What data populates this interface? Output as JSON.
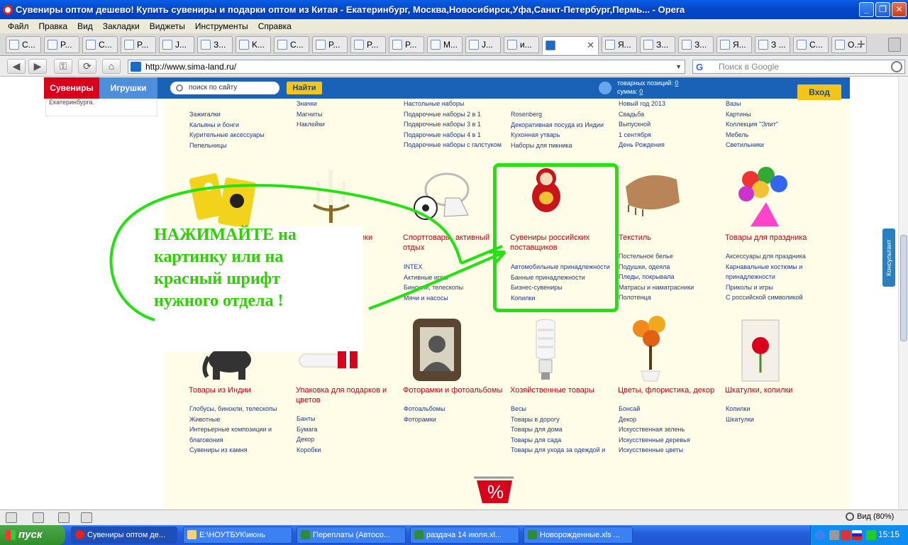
{
  "window": {
    "title": "Сувениры оптом дешево! Купить сувениры и подарки оптом из Китая - Екатеринбург, Москва,Новосибирск,Уфа,Санкт-Петербург,Пермь... - Opera",
    "minimize_glyph": "_",
    "maximize_glyph": "❐",
    "close_glyph": "✕"
  },
  "menu": [
    "Файл",
    "Правка",
    "Вид",
    "Закладки",
    "Виджеты",
    "Инструменты",
    "Справка"
  ],
  "tabs": [
    {
      "label": "C..."
    },
    {
      "label": "P..."
    },
    {
      "label": "C..."
    },
    {
      "label": "P..."
    },
    {
      "label": "J..."
    },
    {
      "label": "З..."
    },
    {
      "label": "K..."
    },
    {
      "label": "C..."
    },
    {
      "label": "P..."
    },
    {
      "label": "P..."
    },
    {
      "label": "P..."
    },
    {
      "label": "M..."
    },
    {
      "label": "J..."
    },
    {
      "label": "и..."
    },
    {
      "label": "",
      "active": true
    },
    {
      "label": "Я..."
    },
    {
      "label": "З..."
    },
    {
      "label": "З..."
    },
    {
      "label": "Я..."
    },
    {
      "label": "З ..."
    },
    {
      "label": "C..."
    },
    {
      "label": "O..."
    }
  ],
  "tab_add_glyph": "+",
  "tab_close_glyph": "✕",
  "address": {
    "url": "http://www.sima-land.ru/",
    "dropdown_glyph": "▼",
    "search_placeholder": "Поиск в Google",
    "google_glyph": "G"
  },
  "nav": {
    "back": "◀",
    "forward": "▶",
    "reload": "⟳",
    "home": "⌂",
    "key": "⚿"
  },
  "site": {
    "tab_souvenirs": "Сувениры",
    "tab_toys": "Игрушки",
    "search_placeholder": "поиск по сайту",
    "find_button": "Найти",
    "cart_positions_label": "товарных позиций:",
    "cart_positions_value": "0",
    "cart_sum_label": "сумма:",
    "cart_sum_value": "0",
    "login_button": "Вход",
    "left_panel_text": "Екатеринбурга."
  },
  "top_links": {
    "col1": [
      "Зажигалки",
      "Кальяны и бонги",
      "Курительные аксессуары",
      "Пепельницы"
    ],
    "col2": [
      "Значки",
      "Магниты",
      "Наклейки"
    ],
    "col3": [
      "Настольные наборы",
      "Подарочные наборы 2 в 1",
      "Подарочные наборы 3 в 1",
      "Подарочные наборы 4 в 1",
      "Подарочные наборы с галстуком"
    ],
    "col4": [
      "Rosenberg",
      "Декоративная посуда из Индии",
      "Кухонная утварь",
      "Наборы для пикника"
    ],
    "col5": [
      "Новый год 2013",
      "Свадьба",
      "Выпускной",
      "1 сентября",
      "День Рождения"
    ],
    "col6": [
      "Вазы",
      "Картины",
      "Коллекция \"Элит\"",
      "Мебель",
      "Светильники"
    ]
  },
  "row2": {
    "partial_title_col2": "ики",
    "sport_title": "Спорттовары, активный отдых",
    "sport_links": [
      "INTEX",
      "Активные игры",
      "Бинокли, телескопы",
      "Мячи и насосы"
    ],
    "russian_title": "Сувениры российских поставщиков",
    "russian_links": [
      "Автомобильные принадлежности",
      "Банные принадлежности",
      "Бизнес-сувениры",
      "Копилки"
    ],
    "textile_title": "Текстиль",
    "textile_links": [
      "Постельное белье",
      "Подушки, одеяла",
      "Пледы, покрывала",
      "Матрасы и наматрасники",
      "Полотенца"
    ],
    "party_title": "Товары для праздника",
    "party_links": [
      "Аксессуары для праздника",
      "Карнавальные костюмы и",
      "принадлежности",
      "Приколы и игры",
      "С российской символикой"
    ]
  },
  "row3": {
    "india_title": "Товары из Индии",
    "india_links": [
      "Глобусы, бинокли, телескопы",
      "Животные",
      "Интерьерные композиции и",
      "благовония",
      "Сувениры из камня"
    ],
    "pack_title": "Упаковка для подарков и цветов",
    "pack_links": [
      "Банты",
      "Бумага",
      "Декор",
      "Коробки"
    ],
    "photo_title": "Фоторамки и фотоальбомы",
    "photo_links": [
      "Фотоальбомы",
      "Фоторамки"
    ],
    "house_title": "Хозяйственные товары",
    "house_links": [
      "Весы",
      "Товары в дорогу",
      "Товары для дома",
      "Товары для сада",
      "Товары для ухода за одеждой и"
    ],
    "flowers_title": "Цветы, флористика, декор",
    "flowers_links": [
      "Бонсай",
      "Декор",
      "Искусственная зелень",
      "Искусственные деревья",
      "Искусственные цветы"
    ],
    "boxes_title": "Шкатулки, копилки",
    "boxes_links": [
      "Копилки",
      "Шкатулки"
    ]
  },
  "annotation": {
    "lines": [
      "НАЖИМАЙТЕ на",
      "картинку или на",
      "красный шрифт",
      "нужного отдела !"
    ],
    "color": "#2bd200"
  },
  "sale_badge": "%",
  "consultant": "Консультант",
  "status": {
    "zoom": "Вид (80%)"
  },
  "taskbar": {
    "start": "пуск",
    "tasks": [
      {
        "label": "Сувениры оптом де...",
        "active": true
      },
      {
        "label": "E:\\НОУТБУК\\июнь"
      },
      {
        "label": "Переплаты (Автосо..."
      },
      {
        "label": "раздача 14 июля.xl..."
      },
      {
        "label": "Новорожденные.xls ..."
      }
    ],
    "clock": "15:15"
  }
}
